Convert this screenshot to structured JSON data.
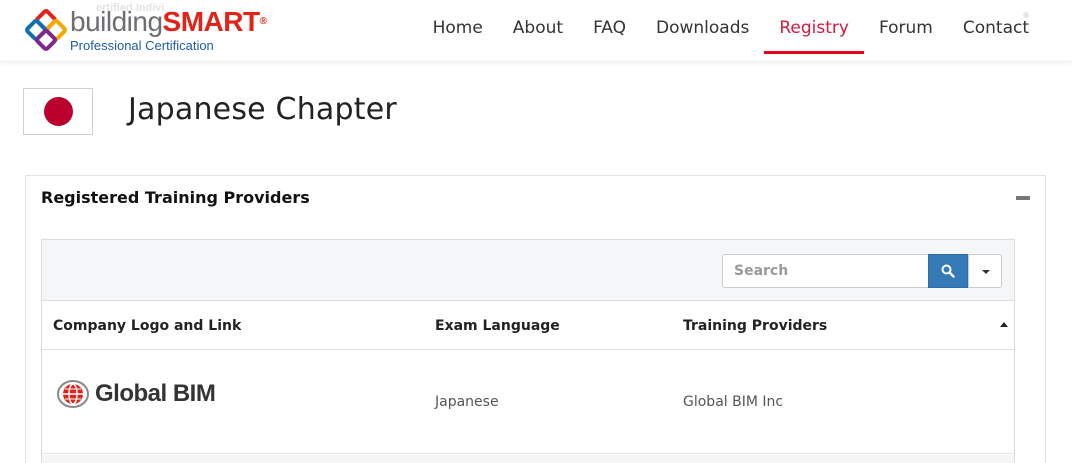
{
  "header": {
    "logo": {
      "ghost_text": "ertified Indivi",
      "word_gray": "building",
      "word_red": "SMART",
      "registered": "®",
      "subtitle": "Professional Certification"
    },
    "nav": [
      {
        "label": "Home",
        "active": false
      },
      {
        "label": "About",
        "active": false
      },
      {
        "label": "FAQ",
        "active": false
      },
      {
        "label": "Downloads",
        "active": false
      },
      {
        "label": "Registry",
        "active": true
      },
      {
        "label": "Forum",
        "active": false
      },
      {
        "label": "Contact",
        "active": false
      }
    ]
  },
  "page": {
    "title": "Japanese Chapter",
    "flag": "japan-flag"
  },
  "panel": {
    "title": "Registered Training Providers",
    "collapse_icon": "minus-icon",
    "search": {
      "placeholder": "Search",
      "value": "",
      "button_icon": "search-icon",
      "dropdown_icon": "caret-down-icon"
    },
    "columns": [
      "Company Logo and Link",
      "Exam Language",
      "Training Providers"
    ],
    "sort_icon": "sort-asc-icon",
    "rows": [
      {
        "logo_text": "Global BIM",
        "exam_language": "Japanese",
        "provider": "Global BIM Inc"
      }
    ]
  },
  "colors": {
    "brand_red": "#e2231a",
    "nav_active": "#d6193f",
    "brand_blue": "#1e5ca8",
    "button_blue": "#337ab7",
    "flag_red": "#bc002d"
  }
}
